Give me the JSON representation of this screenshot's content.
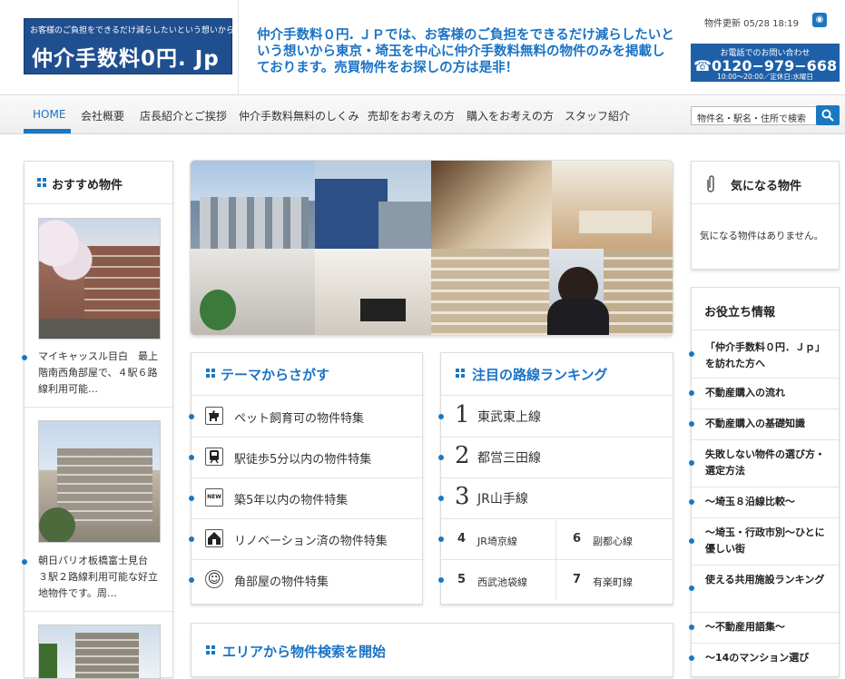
{
  "header": {
    "logo_tagline": "お客様のご負担をできるだけ減らしたいという想いから",
    "logo_name": "仲介手数料0円. Jp",
    "catchphrase": "仲介手数料０円. ＪＰでは、お客様のご負担をできるだけ減らしたいという想いから東京・埼玉を中心に仲介手数料無料の物件のみを掲載しております。売買物件をお探しの方は是非！",
    "update_text": "物件更新 05/28 18:19",
    "rss_icon": "rss-icon",
    "tel_label": "お電話でのお問い合わせ",
    "tel_number": "0120−979−668",
    "tel_hours": "10:00〜20:00／定休日:水曜日"
  },
  "nav": {
    "items": [
      "HOME",
      "会社概要",
      "店長紹介とご挨拶",
      "仲介手数料無料のしくみ",
      "売却をお考えの方",
      "購入をお考えの方",
      "スタッフ紹介"
    ],
    "search_placeholder": "物件名・駅名・住所で検索"
  },
  "recommended": {
    "title": "おすすめ物件",
    "items": [
      {
        "text": "マイキャッスル目白　最上階南西角部屋で、４駅６路線利用可能…"
      },
      {
        "text": "朝日パリオ板橋富士見台　３駅２路線利用可能な好立地物件です。周…"
      }
    ]
  },
  "themes": {
    "title": "テーマからさがす",
    "items": [
      {
        "label": "ペット飼育可の物件特集",
        "icon": "dog-icon"
      },
      {
        "label": "駅徒歩5分以内の物件特集",
        "icon": "train-icon"
      },
      {
        "label": "築5年以内の物件特集",
        "icon": "new-icon"
      },
      {
        "label": "リノベーション済の物件特集",
        "icon": "house-icon"
      },
      {
        "label": "角部屋の物件特集",
        "icon": "smiley-icon"
      }
    ]
  },
  "ranking": {
    "title": "注目の路線ランキング",
    "top": [
      {
        "rank": "1",
        "label": "東武東上線"
      },
      {
        "rank": "2",
        "label": "都営三田線"
      },
      {
        "rank": "3",
        "label": "JR山手線"
      }
    ],
    "rest": [
      {
        "rank": "4",
        "label": "JR埼京線"
      },
      {
        "rank": "6",
        "label": "副都心線"
      },
      {
        "rank": "5",
        "label": "西武池袋線"
      },
      {
        "rank": "7",
        "label": "有楽町線"
      }
    ]
  },
  "area": {
    "title": "エリアから物件検索を開始"
  },
  "favorites": {
    "title": "気になる物件",
    "empty_text": "気になる物件はありません。"
  },
  "info": {
    "title": "お役立ち情報",
    "items": [
      "「仲介手数料０円．Ｊｐ」を訪れた方へ",
      "不動産購入の流れ",
      "不動産購入の基礎知識",
      "失敗しない物件の選び方・選定方法",
      "〜埼玉８沿線比較〜",
      "〜埼玉・行政市別〜ひとに優しい街",
      "使える共用施設ランキング",
      "〜不動産用語集〜",
      "〜14のマンション選び"
    ]
  },
  "colors": {
    "accent": "#1a78c2",
    "logo_bg": "#1f4f8f",
    "catch_text": "#1a73c6"
  }
}
